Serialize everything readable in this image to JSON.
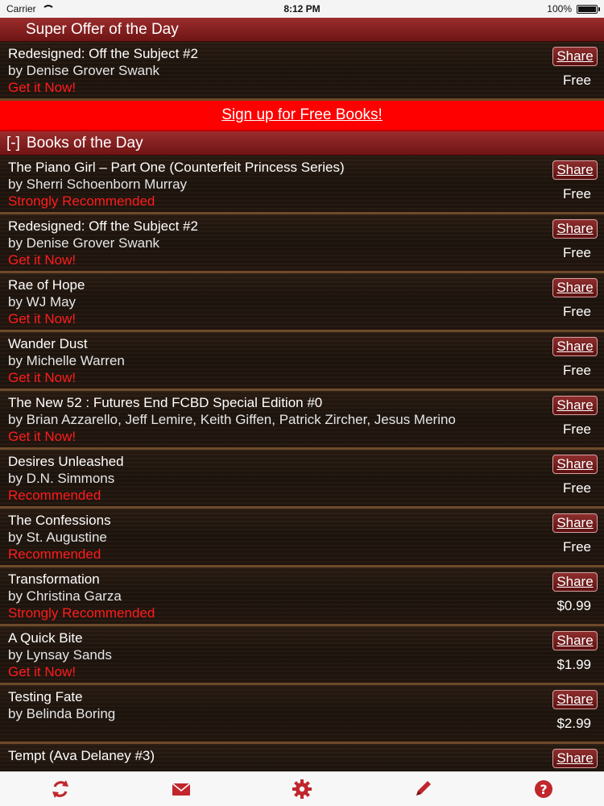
{
  "status_bar": {
    "carrier": "Carrier",
    "time": "8:12 PM",
    "battery": "100%"
  },
  "super_offer": {
    "title": "Super Offer of the Day",
    "book": {
      "title": "Redesigned: Off the Subject #2",
      "author": "by Denise Grover Swank",
      "tag": "Get it Now!",
      "price": "Free",
      "share_label": "Share"
    }
  },
  "signup": {
    "label": "Sign up for Free Books!"
  },
  "books_of_day": {
    "toggle": "[-]",
    "title": "Books of the Day",
    "share_label": "Share",
    "items": [
      {
        "title": "The Piano Girl – Part One (Counterfeit Princess Series)",
        "author": "by Sherri Schoenborn Murray",
        "tag": "Strongly Recommended",
        "price": "Free"
      },
      {
        "title": "Redesigned: Off the Subject #2",
        "author": "by Denise Grover Swank",
        "tag": "Get it Now!",
        "price": "Free"
      },
      {
        "title": "Rae of Hope",
        "author": "by WJ May",
        "tag": "Get it Now!",
        "price": "Free"
      },
      {
        "title": "Wander Dust",
        "author": "by Michelle Warren",
        "tag": "Get it Now!",
        "price": "Free"
      },
      {
        "title": "The New 52 : Futures End FCBD Special Edition #0",
        "author": "by Brian Azzarello, Jeff Lemire, Keith Giffen, Patrick Zircher, Jesus Merino",
        "tag": "Get it Now!",
        "price": "Free"
      },
      {
        "title": "Desires Unleashed",
        "author": "by D.N. Simmons",
        "tag": "Recommended",
        "price": "Free"
      },
      {
        "title": "The Confessions",
        "author": "by St. Augustine",
        "tag": "Recommended",
        "price": "Free"
      },
      {
        "title": "Transformation",
        "author": "by Christina Garza",
        "tag": "Strongly Recommended",
        "price": "$0.99"
      },
      {
        "title": "A Quick Bite",
        "author": "by Lynsay Sands",
        "tag": "Get it Now!",
        "price": "$1.99"
      },
      {
        "title": "Testing Fate",
        "author": "by Belinda Boring",
        "tag": "",
        "price": "$2.99"
      },
      {
        "title": "Tempt (Ava Delaney #3)",
        "author": "",
        "tag": "",
        "price": ""
      }
    ]
  },
  "toolbar": {
    "icons": [
      "refresh-icon",
      "mail-icon",
      "settings-icon",
      "pencil-icon",
      "help-icon"
    ],
    "accent": "#c0262c"
  }
}
